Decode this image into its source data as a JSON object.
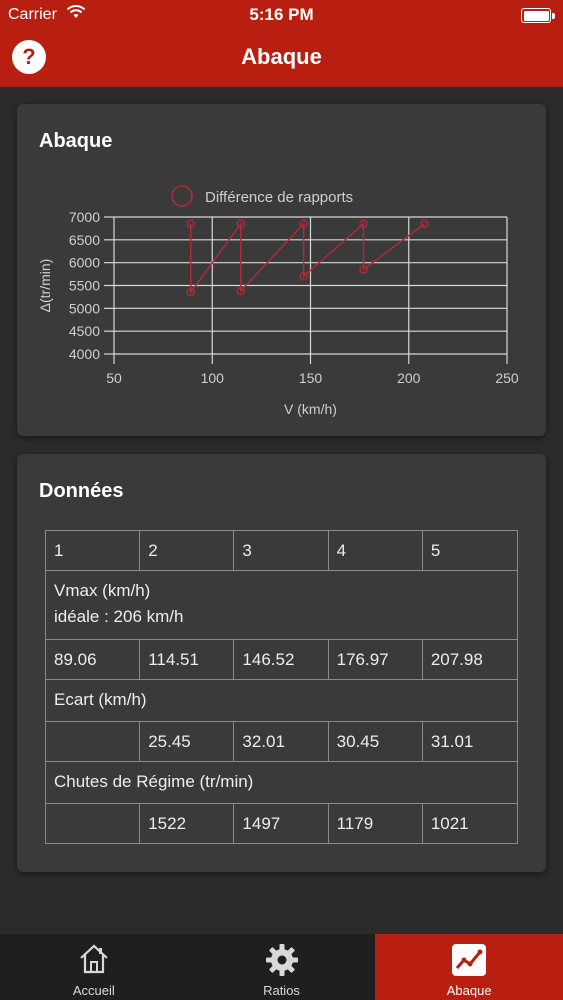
{
  "status_bar": {
    "carrier": "Carrier",
    "time": "5:16 PM"
  },
  "nav": {
    "title": "Abaque",
    "help_label": "?"
  },
  "chart_card": {
    "title": "Abaque"
  },
  "chart_data": {
    "type": "line",
    "legend": "Différence de rapports",
    "xlabel": "V (km/h)",
    "ylabel": "Δ(tr/min)",
    "xlim": [
      50,
      250
    ],
    "ylim": [
      4000,
      7000
    ],
    "x_ticks": [
      50,
      100,
      150,
      200,
      250
    ],
    "y_ticks": [
      4000,
      4500,
      5000,
      5500,
      6000,
      6500,
      7000
    ],
    "grid": true,
    "series_color": "#b02a3a",
    "points": [
      {
        "x": 89.06,
        "y": 6850
      },
      {
        "x": 89.06,
        "y": 5350
      },
      {
        "x": 114.51,
        "y": 6850
      },
      {
        "x": 114.51,
        "y": 5380
      },
      {
        "x": 146.52,
        "y": 6850
      },
      {
        "x": 146.52,
        "y": 5700
      },
      {
        "x": 176.97,
        "y": 6850
      },
      {
        "x": 176.97,
        "y": 5850
      },
      {
        "x": 207.98,
        "y": 6850
      }
    ]
  },
  "data_card": {
    "title": "Données",
    "gears": [
      "1",
      "2",
      "3",
      "4",
      "5"
    ],
    "vmax_label": "Vmax (km/h)",
    "vmax_ideal": "idéale : 206 km/h",
    "vmax_values": [
      "89.06",
      "114.51",
      "146.52",
      "176.97",
      "207.98"
    ],
    "ecart_label": "Ecart (km/h)",
    "ecart_values": [
      "",
      "25.45",
      "32.01",
      "30.45",
      "31.01"
    ],
    "chutes_label": "Chutes de Régime (tr/min)",
    "chutes_values": [
      "",
      "1522",
      "1497",
      "1179",
      "1021"
    ]
  },
  "tabs": [
    {
      "label": "Accueil",
      "icon": "home-icon"
    },
    {
      "label": "Ratios",
      "icon": "gear-icon"
    },
    {
      "label": "Abaque",
      "icon": "chart-icon",
      "active": true
    }
  ],
  "colors": {
    "accent": "#b81f10",
    "background": "#2b2b2b",
    "card": "#3a3a3a",
    "tabbar": "#1f1f1f"
  }
}
